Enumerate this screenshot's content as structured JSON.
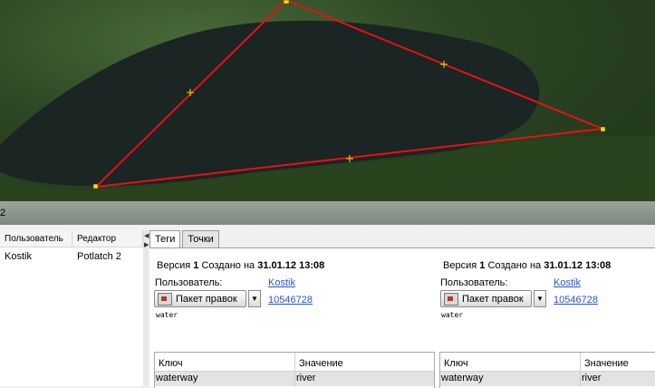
{
  "splitter": {
    "number": "2"
  },
  "history_table": {
    "headers": [
      "Пользователь",
      "Редактор"
    ],
    "rows": [
      {
        "user": "Kostik",
        "editor": "Potlatch 2"
      }
    ]
  },
  "tabs": [
    {
      "label": "Теги",
      "active": true
    },
    {
      "label": "Точки",
      "active": false
    }
  ],
  "versions": [
    {
      "prefix": "Версия",
      "number": "1",
      "created_label": "Создано на",
      "date": "31.01.12 13:08",
      "user_label": "Пользователь:",
      "user": "Kostik",
      "changeset_button": "Пакет правок",
      "changeset_id": "10546728",
      "comment": "water",
      "tag_headers": {
        "key": "Ключ",
        "value": "Значение"
      },
      "tags": [
        {
          "key": "waterway",
          "value": "river"
        }
      ]
    },
    {
      "prefix": "Версия",
      "number": "1",
      "created_label": "Создано на",
      "date": "31.01.12 13:08",
      "user_label": "Пользователь:",
      "user": "Kostik",
      "changeset_button": "Пакет правок",
      "changeset_id": "10546728",
      "comment": "water",
      "tag_headers": {
        "key": "Ключ",
        "value": "Значение"
      },
      "tags": [
        {
          "key": "waterway",
          "value": "river"
        }
      ]
    }
  ],
  "colors": {
    "way_line": "#e8110f",
    "node_fill": "#f5e000",
    "link": "#2b53c5"
  }
}
